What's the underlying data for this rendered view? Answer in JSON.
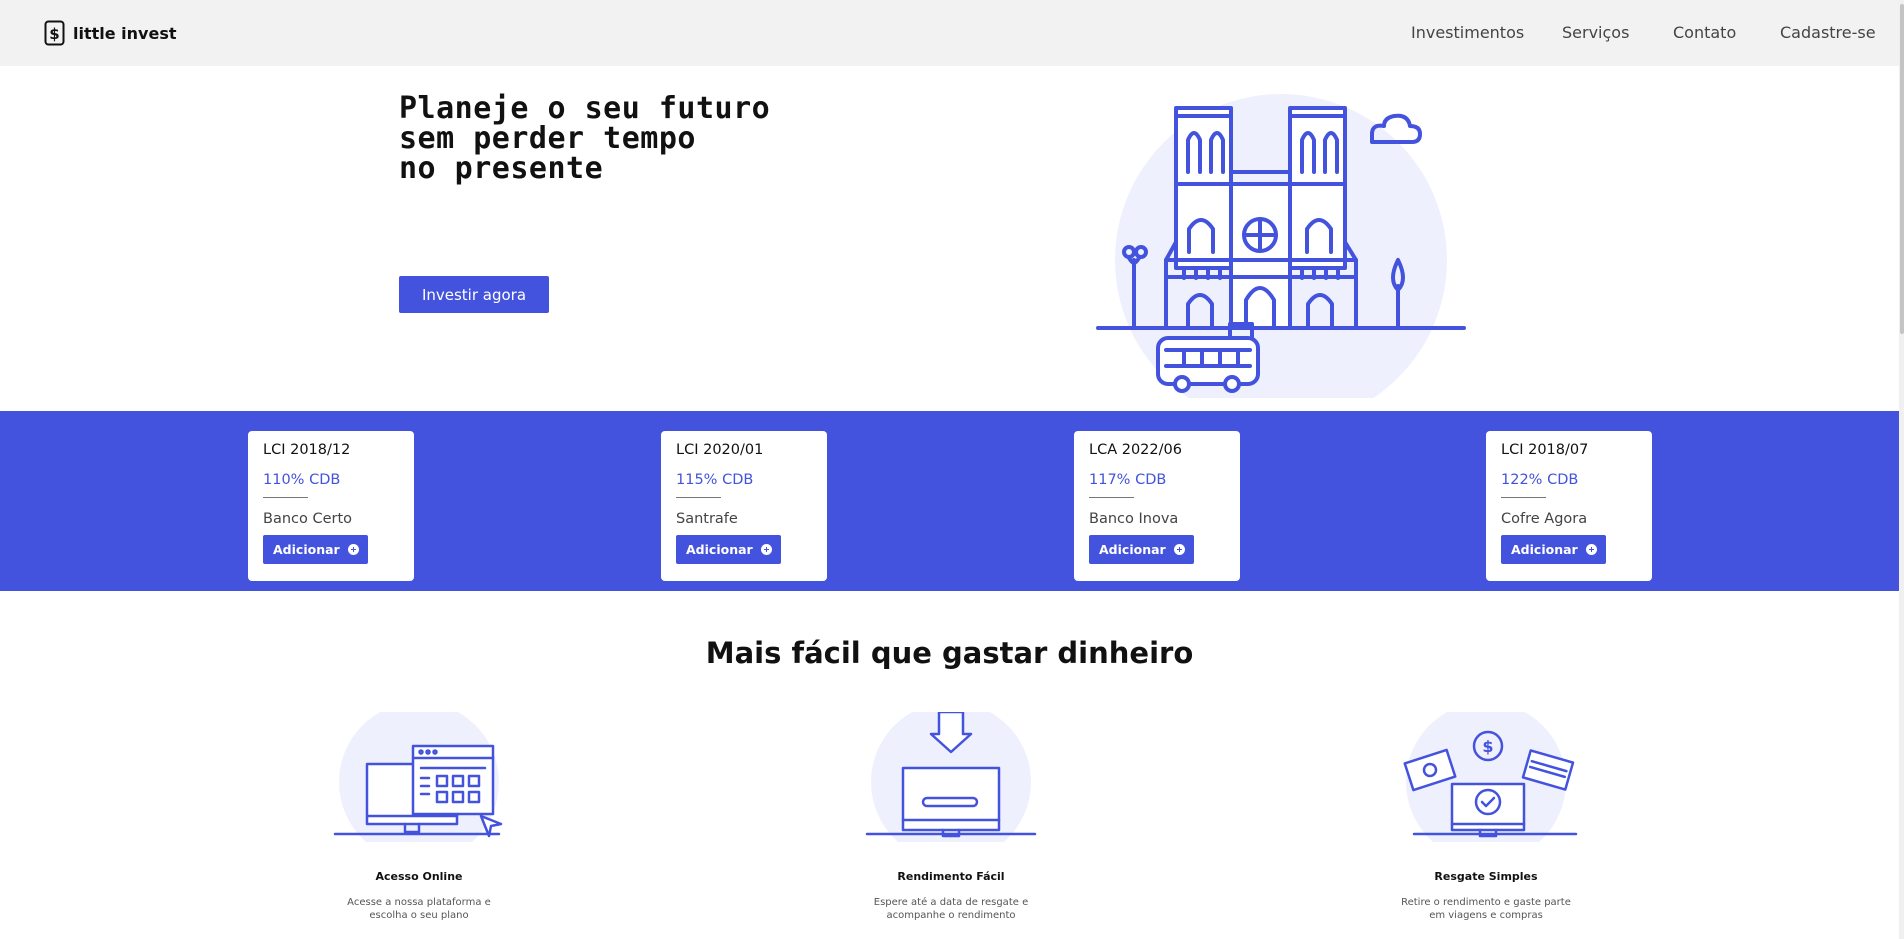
{
  "brand": {
    "name": "little invest",
    "icon": "dollar-icon"
  },
  "nav": [
    "Investimentos",
    "Serviços",
    "Contato",
    "Cadastre-se"
  ],
  "hero": {
    "title_lines": [
      "Planeje o seu futuro",
      "sem perder tempo",
      "no presente"
    ],
    "cta": "Investir agora",
    "illustration": "cathedral-illustration"
  },
  "accent_color": "#4353dd",
  "cards": [
    {
      "title": "LCI 2018/12",
      "rate": "110% CDB",
      "bank": "Banco Certo",
      "button": "Adicionar"
    },
    {
      "title": "LCI 2020/01",
      "rate": "115% CDB",
      "bank": "Santrafe",
      "button": "Adicionar"
    },
    {
      "title": "LCA 2022/06",
      "rate": "117% CDB",
      "bank": "Banco Inova",
      "button": "Adicionar"
    },
    {
      "title": "LCI 2018/07",
      "rate": "122% CDB",
      "bank": "Cofre Agora",
      "button": "Adicionar"
    }
  ],
  "features_title": "Mais fácil que gastar dinheiro",
  "features": [
    {
      "title": "Acesso Online",
      "desc": [
        "Acesse a nossa plataforma e",
        "escolha o seu plano"
      ],
      "icon": "online-access-icon"
    },
    {
      "title": "Rendimento Fácil",
      "desc": [
        "Espere até a data de resgate e",
        "acompanhe o rendimento"
      ],
      "icon": "download-monitor-icon"
    },
    {
      "title": "Resgate Simples",
      "desc": [
        "Retire o rendimento e gaste parte",
        "em viagens e compras"
      ],
      "icon": "money-monitor-icon"
    }
  ]
}
